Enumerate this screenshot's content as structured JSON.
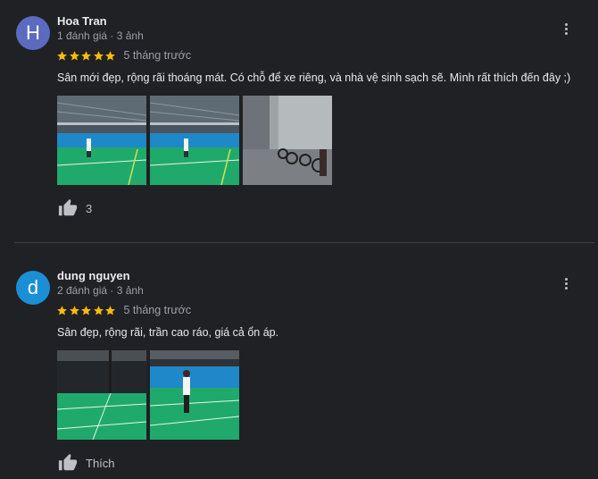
{
  "reviews": [
    {
      "avatar_letter": "H",
      "avatar_color": "#5c6bc0",
      "name": "Hoa Tran",
      "meta": "1 đánh giá · 3 ảnh",
      "stars": 5,
      "time": "5 tháng trước",
      "text": "Sân mới đẹp, rộng rãi thoáng mát. Có chỗ để xe riêng, và nhà vệ sinh sạch sẽ. Mình rất thích đến đây ;)",
      "photos": [
        "badminton court with spectators",
        "badminton court with spectators",
        "bicycles parked in garage"
      ],
      "likes": "3"
    },
    {
      "avatar_letter": "d",
      "avatar_color": "#1a8fd6",
      "name": "dung nguyen",
      "meta": "2 đánh giá · 3 ảnh",
      "stars": 5,
      "time": "5 tháng trước",
      "text": "Sân đẹp, rộng rãi, trần cao ráo, giá cả ổn áp.",
      "photos": [
        "dark badminton court",
        "player on badminton court"
      ],
      "likes": "Thích"
    }
  ],
  "colors": {
    "star": "#fbbc04",
    "court_green": "#1faa6b",
    "wall_blue": "#1e88c8"
  },
  "icons": {
    "more": "more-vert-icon",
    "like": "thumb-up-icon",
    "star": "star-icon"
  }
}
